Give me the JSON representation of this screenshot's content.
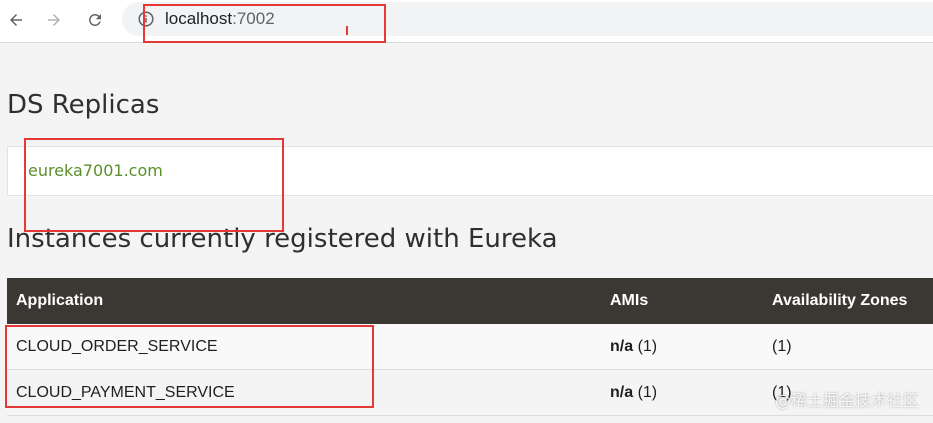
{
  "browser": {
    "url_host": "localhost",
    "url_port": ":7002"
  },
  "replicas": {
    "title": "DS Replicas",
    "link": "eureka7001.com"
  },
  "instances": {
    "title": "Instances currently registered with Eureka",
    "columns": [
      "Application",
      "AMIs",
      "Availability Zones"
    ],
    "rows": [
      {
        "application": "CLOUD_ORDER_SERVICE",
        "ami_value": "n/a",
        "ami_count": " (1)",
        "zones": "(1)"
      },
      {
        "application": "CLOUD_PAYMENT_SERVICE",
        "ami_value": "n/a",
        "ami_count": " (1)",
        "zones": "(1)"
      }
    ]
  },
  "watermark": "@稀土掘金技术社区",
  "colors": {
    "header_bg": "#3b3833",
    "link": "#5b8f2a",
    "annotation": "#e53935"
  }
}
